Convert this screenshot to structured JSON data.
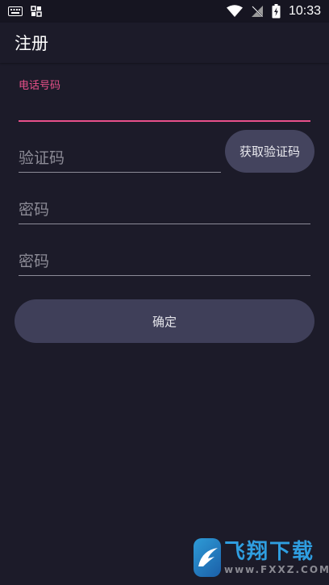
{
  "status_bar": {
    "time": "10:33",
    "icons": [
      "keyboard-icon",
      "screenshot-icon",
      "wifi-icon",
      "no-signal-icon",
      "battery-charging-icon"
    ]
  },
  "app_bar": {
    "title": "注册"
  },
  "form": {
    "phone_label": "电话号码",
    "phone_value": "",
    "code_placeholder": "验证码",
    "get_code_label": "获取验证码",
    "password_placeholder": "密码",
    "confirm_password_placeholder": "密码",
    "confirm_label": "确定"
  },
  "watermark": {
    "cn": "飞翔下载",
    "en": "www.FXXZ.COM"
  },
  "colors": {
    "background": "#1c1b29",
    "accent": "#e8508a",
    "button": "#44445e"
  }
}
